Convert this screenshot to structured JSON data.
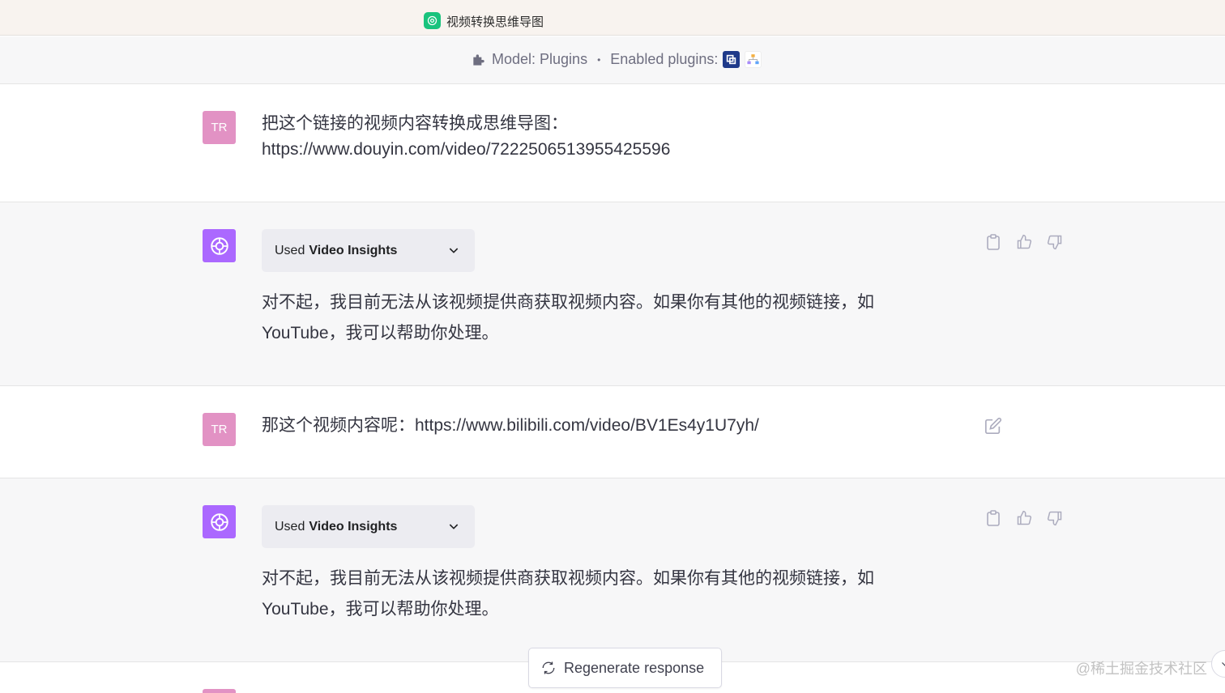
{
  "tab": {
    "title": "视频转换思维导图",
    "favicon": "openai-icon"
  },
  "model_bar": {
    "model_label": "Model: Plugins",
    "separator": "•",
    "enabled_label": "Enabled plugins:",
    "plugins": [
      "video-insights-icon",
      "mindmap-plugin-icon"
    ]
  },
  "messages": [
    {
      "role": "user",
      "avatar": "TR",
      "lines": [
        "把这个链接的视频内容转换成思维导图：",
        "https://www.douyin.com/video/7222506513955425596"
      ]
    },
    {
      "role": "assistant",
      "used_prefix": "Used",
      "plugin_name": "Video Insights",
      "lines": [
        "对不起，我目前无法从该视频提供商获取视频内容。如果你有其他的视频链接，如",
        "YouTube，我可以帮助你处理。"
      ]
    },
    {
      "role": "user",
      "avatar": "TR",
      "lines": [
        "那这个视频内容呢：https://www.bilibili.com/video/BV1Es4y1U7yh/"
      ]
    },
    {
      "role": "assistant",
      "used_prefix": "Used",
      "plugin_name": "Video Insights",
      "lines": [
        "对不起，我目前无法从该视频提供商获取视频内容。如果你有其他的视频链接，如",
        "YouTube，我可以帮助你处理。"
      ]
    }
  ],
  "regenerate_label": "Regenerate response",
  "watermark": "@稀土掘金技术社区",
  "colors": {
    "user_avatar": "#e292c4",
    "gpt_avatar": "#ab68ff",
    "bot_row_bg": "#f7f7f8"
  }
}
